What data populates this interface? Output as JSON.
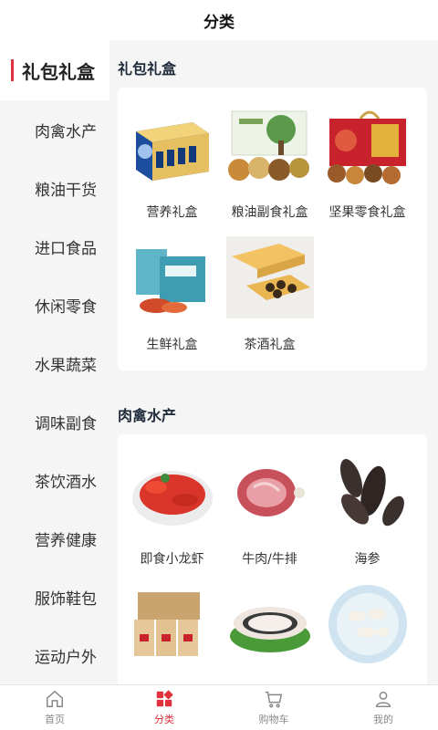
{
  "header": {
    "title": "分类"
  },
  "sidebar": {
    "items": [
      {
        "label": "礼包礼盒",
        "active": true
      },
      {
        "label": "肉禽水产"
      },
      {
        "label": "粮油干货"
      },
      {
        "label": "进口食品"
      },
      {
        "label": "休闲零食"
      },
      {
        "label": "水果蔬菜"
      },
      {
        "label": "调味副食"
      },
      {
        "label": "茶饮酒水"
      },
      {
        "label": "营养健康"
      },
      {
        "label": "服饰鞋包"
      },
      {
        "label": "运动户外"
      }
    ]
  },
  "sections": [
    {
      "title": "礼包礼盒",
      "items": [
        {
          "label": "营养礼盒",
          "image": "nutrition-gift-box-image"
        },
        {
          "label": "粮油副食礼盒",
          "image": "grain-oil-gift-box-image"
        },
        {
          "label": "坚果零食礼盒",
          "image": "nut-snack-gift-box-image"
        },
        {
          "label": "生鲜礼盒",
          "image": "fresh-food-gift-box-image"
        },
        {
          "label": "茶酒礼盒",
          "image": "tea-wine-gift-box-image"
        }
      ]
    },
    {
      "title": "肉禽水产",
      "items": [
        {
          "label": "即食小龙虾",
          "image": "crayfish-image"
        },
        {
          "label": "牛肉/牛排",
          "image": "beef-image"
        },
        {
          "label": "海参",
          "image": "sea-cucumber-image"
        },
        {
          "label": "",
          "image": "boxed-poultry-image"
        },
        {
          "label": "",
          "image": "sliced-fish-image"
        },
        {
          "label": "",
          "image": "seafood-platter-image"
        }
      ]
    }
  ],
  "tabbar": {
    "tabs": [
      {
        "label": "首页",
        "icon": "home-icon"
      },
      {
        "label": "分类",
        "icon": "category-icon",
        "active": true
      },
      {
        "label": "购物车",
        "icon": "cart-icon"
      },
      {
        "label": "我的",
        "icon": "user-icon"
      }
    ]
  },
  "colors": {
    "accent": "#e0323c",
    "background": "#f5f5f5",
    "card": "#ffffff"
  }
}
